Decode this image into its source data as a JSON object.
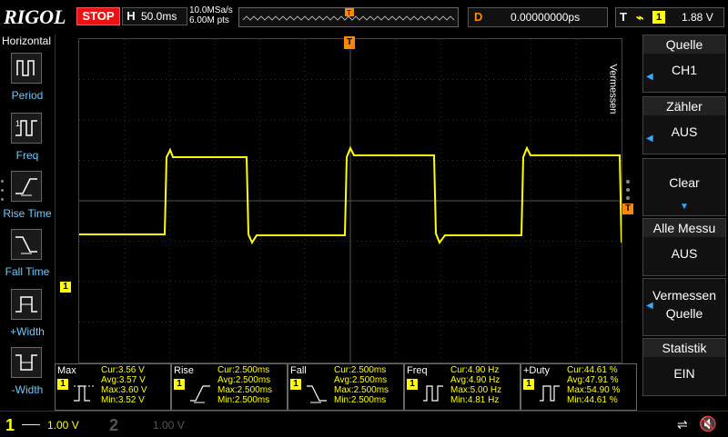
{
  "brand": "RIGOL",
  "run_state": "STOP",
  "horizontal": {
    "key": "H",
    "timebase": "50.0ms"
  },
  "acquisition": {
    "sample_rate": "10.0MSa/s",
    "memory_depth": "6.00M pts"
  },
  "delay": {
    "key": "D",
    "value": "0.00000000ps"
  },
  "trigger": {
    "key": "T",
    "edge_symbol": "⌒",
    "channel": "1",
    "level": "1.88 V"
  },
  "left_menu": {
    "title": "Horizontal",
    "items": [
      {
        "label": "Period",
        "icon": "period-icon"
      },
      {
        "label": "Freq",
        "icon": "freq-icon"
      },
      {
        "label": "Rise Time",
        "icon": "rise-time-icon"
      },
      {
        "label": "Fall Time",
        "icon": "fall-time-icon"
      },
      {
        "label": "+Width",
        "icon": "pos-width-icon"
      },
      {
        "label": "-Width",
        "icon": "neg-width-icon"
      }
    ]
  },
  "right_menu": {
    "section_label": "Vermessen",
    "items": [
      {
        "title": "Quelle",
        "value": "CH1"
      },
      {
        "title": "Zähler",
        "value": "AUS"
      },
      {
        "title": "",
        "value": "Clear"
      },
      {
        "title": "Alle Messu",
        "value": "AUS"
      },
      {
        "title": "Vermessen",
        "value": "Quelle"
      },
      {
        "title": "Statistik",
        "value": "EIN"
      }
    ]
  },
  "measurements": [
    {
      "name": "Max",
      "channel": "1",
      "cur": "Cur:3.56 V",
      "avg": "Avg:3.57 V",
      "max": "Max:3.60 V",
      "min": "Min:3.52 V"
    },
    {
      "name": "Rise",
      "channel": "1",
      "cur": "Cur:2.500ms",
      "avg": "Avg:2.500ms",
      "max": "Max:2.500ms",
      "min": "Min:2.500ms"
    },
    {
      "name": "Fall",
      "channel": "1",
      "cur": "Cur:2.500ms",
      "avg": "Avg:2.500ms",
      "max": "Max:2.500ms",
      "min": "Min:2.500ms"
    },
    {
      "name": "Freq",
      "channel": "1",
      "cur": "Cur:4.90 Hz",
      "avg": "Avg:4.90 Hz",
      "max": "Max:5.00 Hz",
      "min": "Min:4.81 Hz"
    },
    {
      "name": "+Duty",
      "channel": "1",
      "cur": "Cur:44.61 %",
      "avg": "Avg:47.91 %",
      "max": "Max:54.90 %",
      "min": "Min:44.61 %"
    }
  ],
  "channels": [
    {
      "num": "1",
      "scale": "1.00 V",
      "color": "#ffff00"
    },
    {
      "num": "2",
      "scale": "1.00 V",
      "color": "#555555"
    }
  ],
  "markers": {
    "ch1": "1",
    "trigger": "T"
  },
  "colors": {
    "trace": "#ffff00",
    "trigger": "#ff8800",
    "accent": "#33aaff"
  }
}
